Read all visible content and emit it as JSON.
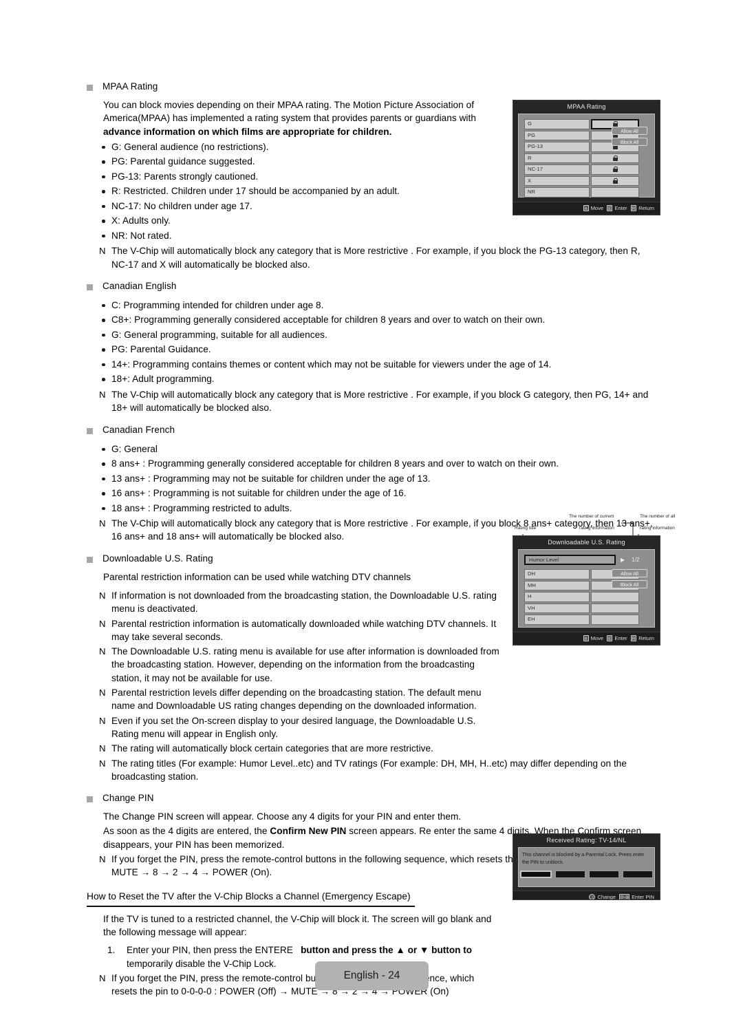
{
  "page": {
    "footer_tag": "English - 24"
  },
  "sections": [
    {
      "id": "mpaa",
      "heading": "MPAA Rating",
      "paragraphs": [
        "You can block movies depending on their MPAA rating. The Motion Picture Association of America(MPAA) has implemented a rating system that provides parents or guardians with ",
        "advance information on which films are appropriate for children."
      ],
      "bullets": [
        "G: General audience (no restrictions).",
        "PG: Parental guidance suggested.",
        "PG-13: Parents strongly cautioned.",
        "R: Restricted. Children under 17 should be accompanied by an adult.",
        "NC-17: No children under age 17.",
        "X: Adults only.",
        "NR: Not rated."
      ],
      "notes": [
        "The V-Chip will automatically block any category that is  More restrictive . For example, if you block the PG-13 category, then R, NC-17 and X will automatically be blocked also."
      ]
    },
    {
      "id": "canadian-english",
      "heading": "Canadian English",
      "bullets": [
        "C: Programming intended for children under age 8.",
        "C8+: Programming generally considered acceptable for children 8 years and over to watch on their own.",
        "G: General programming, suitable for all audiences.",
        "PG: Parental Guidance.",
        "14+: Programming contains themes or content which may not be suitable for viewers under the age of 14.",
        "18+: Adult programming."
      ],
      "notes": [
        "The V-Chip will automatically block any category that is  More restrictive . For example, if you block G category, then PG, 14+ and 18+ will automatically be blocked also."
      ]
    },
    {
      "id": "canadian-french",
      "heading": "Canadian French",
      "bullets": [
        "G: General",
        "8 ans+ : Programming generally considered acceptable for children 8 years and over to watch on their own.",
        "13 ans+ : Programming may not be suitable for children under the age of 13.",
        "16 ans+ : Programming is not suitable for children under the age of 16.",
        "18 ans+ : Programming restricted to adults."
      ],
      "notes": [
        "The V-Chip will automatically block any category that is  More restrictive . For example, if you block 8 ans+  category, then 13 ans+, 16 ans+  and 18 ans+  will automatically be blocked also."
      ]
    },
    {
      "id": "downloadable",
      "heading": "Downloadable U.S. Rating",
      "paragraphs": [
        "Parental restriction information can be used while watching DTV channels"
      ],
      "notes": [
        "If information is not downloaded from the broadcasting station, the Downloadable U.S. rating  menu is deactivated.",
        "Parental restriction information is automatically downloaded while watching DTV channels. It may take several seconds.",
        "The Downloadable U.S. rating   menu is available for use after information is downloaded from the broadcasting station. However, depending on the information from the broadcasting station, it may not be available for use.",
        "Parental restriction levels differ depending on the broadcasting station. The default menu name and Downloadable US rating changes depending on the downloaded information.",
        "Even if you set the On-screen display to your desired language, the Downloadable U.S. Rating  menu will appear in English only.",
        "The rating will automatically block certain categories that are more restrictive.",
        "The rating titles (For example: Humor Level..etc) and TV ratings (For example: DH, MH, H..etc) may differ depending on the broadcasting station."
      ]
    },
    {
      "id": "change-pin",
      "heading": "Change PIN",
      "paragraphs": [
        "The Change PIN  screen will appear. Choose any 4 digits for your PIN and enter them."
      ],
      "rich_paragraph": {
        "pre": "As soon as the 4 digits are entered, the ",
        "bold": "Confirm New PIN",
        "post": " screen appears. Re enter the same 4 digits. When the Confirm screen disappears, your PIN has been memorized."
      },
      "notes": [
        "If you forget the PIN, press the remote-control buttons in the following sequence, which resets the pin to 0-0-0-0 : POWER (Off) → MUTE → 8 → 2 → 4 → POWER (On)."
      ]
    }
  ],
  "reset_section": {
    "heading": "How to Reset the TV after the V-Chip Blocks a Channel (Emergency Escape)",
    "intro": "If the TV is tuned to a restricted channel, the V-Chip will block it. The screen will go blank and the following message will appear:",
    "step_number": "1.",
    "step_pre": "Enter your PIN, then press the ENTERE",
    "step_bold": "button and press the ▲ or ▼ button to",
    "step_post": "temporarily disable the V-Chip Lock.",
    "note": "If you forget the PIN, press the remote-control buttons in the following sequence, which resets the pin to 0-0-0-0 : POWER (Off) → MUTE → 8 → 2 → 4 → POWER (On)"
  },
  "note_marker": "N",
  "osd_mpaa": {
    "title": "MPAA Rating",
    "rows": [
      {
        "label": "G",
        "locked": true,
        "selected": true
      },
      {
        "label": "PG",
        "locked": true,
        "selected": false
      },
      {
        "label": "PG-13",
        "locked": true,
        "selected": false
      },
      {
        "label": "R",
        "locked": true,
        "selected": false
      },
      {
        "label": "NC-17",
        "locked": true,
        "selected": false
      },
      {
        "label": "X",
        "locked": true,
        "selected": false
      },
      {
        "label": "NR",
        "locked": false,
        "selected": false
      }
    ],
    "buttons": [
      "Allow All",
      "Block All"
    ],
    "footer": [
      {
        "key": "n",
        "label": "Move"
      },
      {
        "key": "E",
        "label": "Enter"
      },
      {
        "key": "R",
        "label": "Return"
      }
    ]
  },
  "osd_downloadable": {
    "callouts": [
      "Rating title",
      "The number of current",
      "rating information",
      "The number of all",
      "rating information"
    ],
    "title": "Downloadable U.S. Rating",
    "rating_title_field": "Humor Level",
    "arrow": "▶",
    "count": "1/2",
    "rows": [
      "DH",
      "MH",
      "H",
      "VH",
      "EH"
    ],
    "buttons": [
      "Allow All",
      "Block All"
    ],
    "footer": [
      {
        "key": "n",
        "label": "Move"
      },
      {
        "key": "E",
        "label": "Enter"
      },
      {
        "key": "R",
        "label": "Return"
      }
    ]
  },
  "osd_received": {
    "title": "Received Rating: TV-14/NL",
    "message": "This channel is blocked by a Parental Lock. Prees enter the PIN to unblock.",
    "pin_digits": 4,
    "footer": [
      {
        "key": "updown",
        "label": "Change"
      },
      {
        "key": "0~9",
        "label": "Enter PIN"
      }
    ]
  },
  "colors": {
    "bullet_square": "#a8a8a8",
    "page_tag_bg": "#b2b2b2",
    "osd_bg": "#262626",
    "osd_panel": "#8e8e8e",
    "osd_row": "#cfcfcf"
  }
}
